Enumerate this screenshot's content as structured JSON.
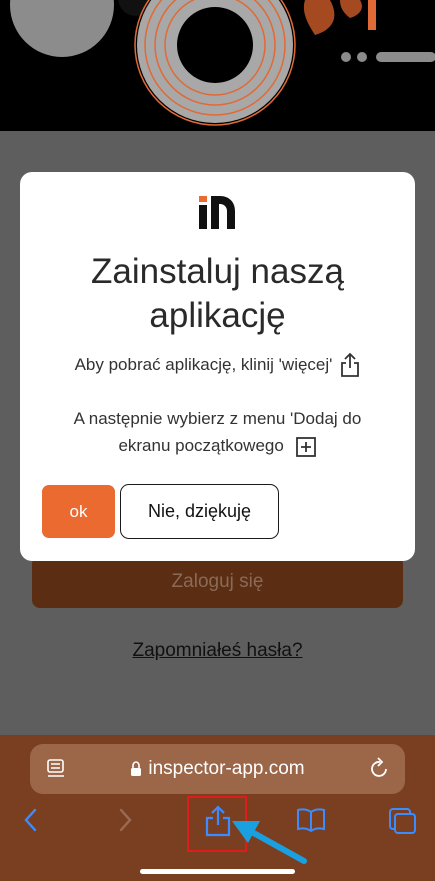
{
  "modal": {
    "title_line1": "Zainstaluj naszą",
    "title_line2": "aplikację",
    "hint_download": "Aby pobrać aplikację, klinij 'więcej'",
    "hint_add": "A następnie wybierz z menu 'Dodaj do ekranu początkowego",
    "ok_label": "ok",
    "decline_label": "Nie, dziękuję"
  },
  "page": {
    "login_label": "Zaloguj się",
    "forgot_label": "Zapomniałeś hasła?"
  },
  "browser": {
    "url": "inspector-app.com"
  },
  "icons": {
    "share": "share-icon",
    "add": "plus-square-icon",
    "lock": "lock-icon",
    "reader": "reader-mode-icon",
    "reload": "reload-icon",
    "back": "chevron-left-icon",
    "forward": "chevron-right-icon",
    "bookmarks": "book-icon",
    "tabs": "tabs-icon",
    "pointer": "arrow-pointer-icon"
  },
  "colors": {
    "accent": "#ea6a2f",
    "browser_bar": "#7a3f20",
    "highlight": "#e01b1b",
    "pointer": "#1aa0e0"
  }
}
